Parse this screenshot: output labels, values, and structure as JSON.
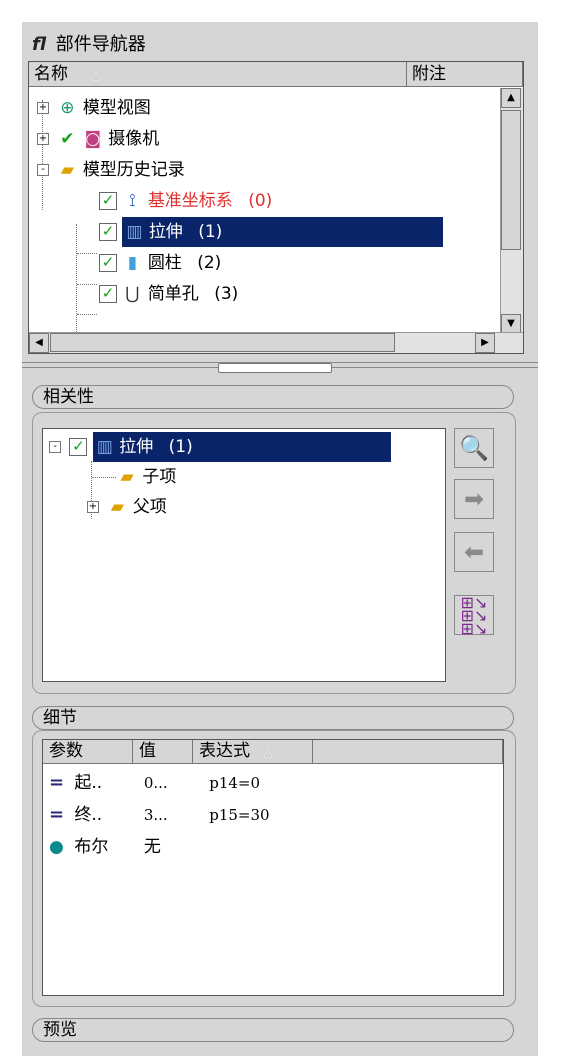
{
  "panel_title": "部件导航器",
  "navigator": {
    "columns": {
      "name": "名称",
      "sort_indicator": "△",
      "notes": "附注"
    },
    "items": [
      {
        "label": "模型视图",
        "icon": "model-view-icon",
        "expander": "+"
      },
      {
        "label": "摄像机",
        "icon": "camera-icon",
        "expander": "+"
      },
      {
        "label": "模型历史记录",
        "icon": "folder-open-icon",
        "expander": "-"
      },
      {
        "label": "基准坐标系",
        "suffix": "(0)",
        "icon": "datum-csys-icon",
        "checked": true,
        "color": "#e03030"
      },
      {
        "label": "拉伸",
        "suffix": "(1)",
        "icon": "extrude-icon",
        "checked": true,
        "selected": true
      },
      {
        "label": "圆柱",
        "suffix": "(2)",
        "icon": "cylinder-icon",
        "checked": true
      },
      {
        "label": "简单孔",
        "suffix": "(3)",
        "icon": "simple-hole-icon",
        "checked": true
      }
    ]
  },
  "dependencies": {
    "title": "相关性",
    "root": {
      "label": "拉伸",
      "suffix": "(1)",
      "expander": "-"
    },
    "children": [
      {
        "label": "子项",
        "icon": "folder-open-icon"
      },
      {
        "label": "父项",
        "icon": "folder-open-icon",
        "expander": "+"
      }
    ]
  },
  "details": {
    "title": "细节",
    "columns": {
      "param": "参数",
      "value": "值",
      "expr": "表达式",
      "sort_indicator": "△"
    },
    "rows": [
      {
        "icon": "equals-icon",
        "param": "起..",
        "value": "0...",
        "expr": "p14=0"
      },
      {
        "icon": "equals-icon",
        "param": "终..",
        "value": "3...",
        "expr": "p15=30"
      },
      {
        "icon": "boolean-icon",
        "param": "布尔",
        "value": "无",
        "expr": ""
      }
    ]
  },
  "preview": {
    "title": "预览"
  },
  "colors": {
    "selection": "#0a246a",
    "panel": "#d6d6d6",
    "datum_red": "#e03030",
    "check_green": "#1aa01a"
  }
}
